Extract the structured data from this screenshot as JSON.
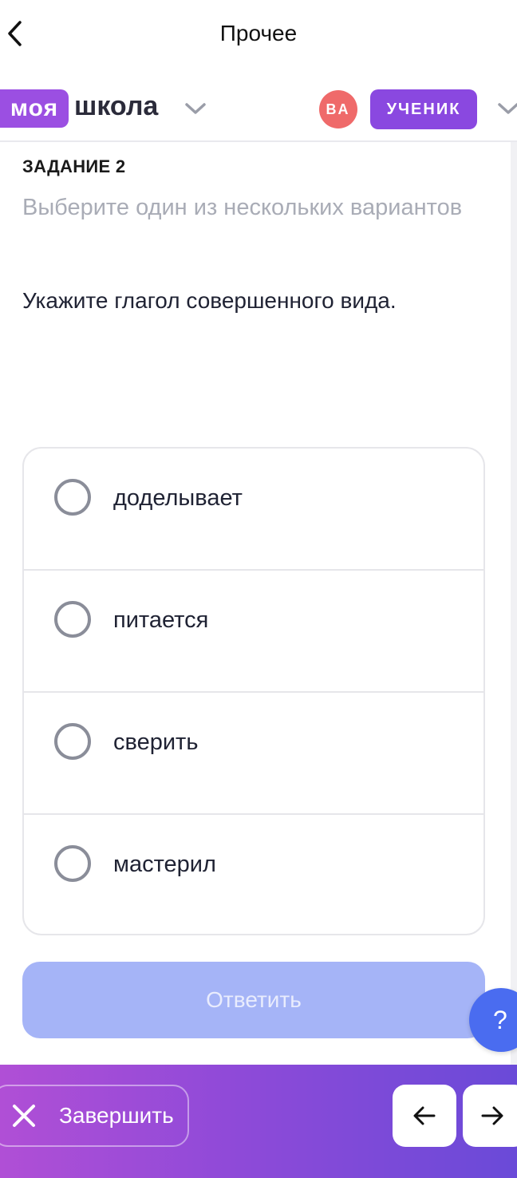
{
  "top_nav": {
    "title": "Прочее"
  },
  "header": {
    "logo_part1": "моя",
    "logo_part2": "школа",
    "avatar_initials": "ВА",
    "role": "УЧЕНИК"
  },
  "task": {
    "label": "ЗАДАНИЕ 2",
    "hint": "Выберите один из нескольких вариантов",
    "question": "Укажите глагол совершенного вида."
  },
  "options": [
    {
      "label": "доделывает"
    },
    {
      "label": "питается"
    },
    {
      "label": "сверить"
    },
    {
      "label": "мастерил"
    }
  ],
  "answer_button": {
    "label": "Ответить"
  },
  "help_button": {
    "label": "?"
  },
  "bottom_bar": {
    "finish_label": "Завершить"
  },
  "colors": {
    "brand_purple": "#9b4fe2",
    "avatar_red": "#ef6a6a",
    "answer_disabled": "#a5b4f7",
    "help_blue": "#4a6cf0"
  }
}
